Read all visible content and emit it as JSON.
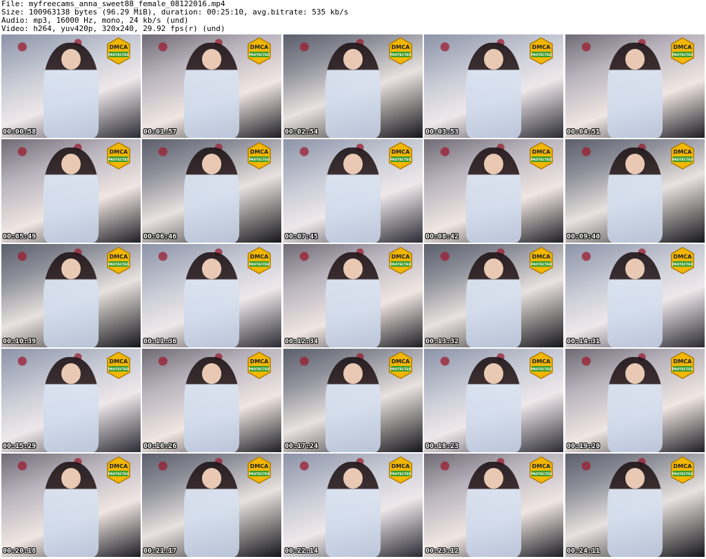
{
  "header": {
    "file_line": "File: myfreecams_anna_sweet88_female_08122016.mp4",
    "size_line": "Size: 100963138 bytes (96.29 MiB), duration: 00:25:10, avg.bitrate: 535 kb/s",
    "audio_line": "Audio: mp3, 16000 Hz, mono, 24 kb/s (und)",
    "video_line": "Video: h264, yuv420p, 320x240, 29.92 fps(r) (und)"
  },
  "badge": {
    "top_text": "DMCA",
    "bottom_text": "PROTECTED",
    "colors": {
      "gold": "#f2b705",
      "green": "#3a9a2a",
      "outline": "#b07c00"
    }
  },
  "thumbnails": [
    "00:00:58",
    "00:01:57",
    "00:02:54",
    "00:03:53",
    "00:04:51",
    "00:05:49",
    "00:06:46",
    "00:07:45",
    "00:08:42",
    "00:09:40",
    "00:10:39",
    "00:11:36",
    "00:12:34",
    "00:13:32",
    "00:14:31",
    "00:15:29",
    "00:16:26",
    "00:17:24",
    "00:18:23",
    "00:19:20",
    "00:20:18",
    "00:21:17",
    "00:22:14",
    "00:23:12",
    "00:24:11"
  ]
}
